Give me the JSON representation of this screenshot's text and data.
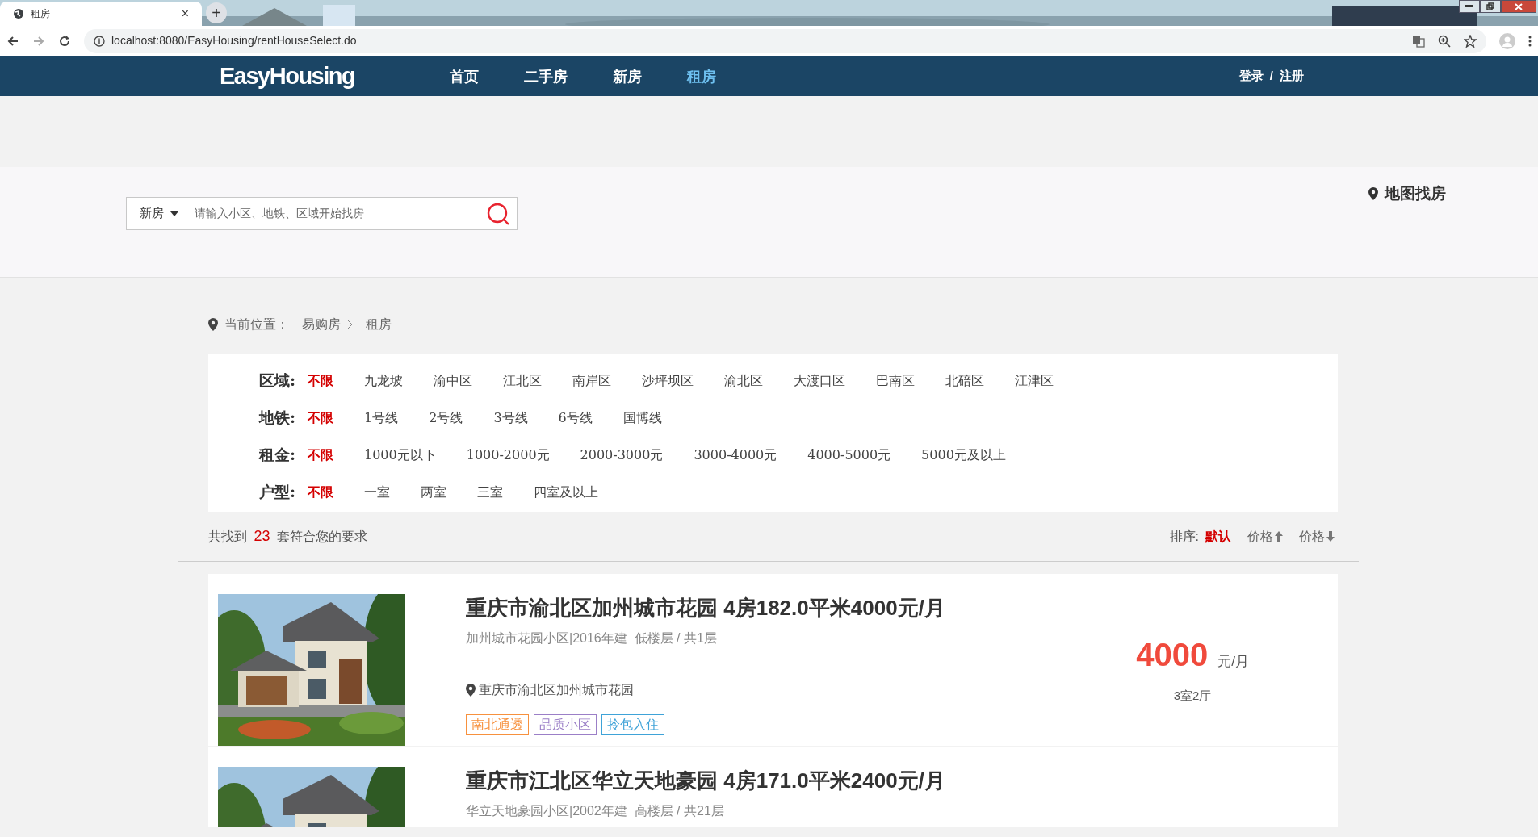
{
  "browser": {
    "tab_title": "租房",
    "tab_close": "×",
    "new_tab": "+",
    "url": "localhost:8080/EasyHousing/rentHouseSelect.do"
  },
  "nav": {
    "logo": "EasyHousing",
    "items": [
      {
        "label": "首页",
        "selected": false
      },
      {
        "label": "二手房",
        "selected": false
      },
      {
        "label": "新房",
        "selected": false
      },
      {
        "label": "租房",
        "selected": true
      }
    ],
    "auth": {
      "login": "登录",
      "separator": "/",
      "register": "注册"
    }
  },
  "search": {
    "type": "新房",
    "placeholder": "请输入小区、地铁、区域开始找房",
    "map_link": "地图找房"
  },
  "breadcrumb": {
    "label": "当前位置：",
    "items": [
      "易购房",
      "租房"
    ]
  },
  "filters": [
    {
      "label": "区域:",
      "options": [
        {
          "label": "不限",
          "selected": true
        },
        {
          "label": "九龙坡",
          "selected": false
        },
        {
          "label": "渝中区",
          "selected": false
        },
        {
          "label": "江北区",
          "selected": false
        },
        {
          "label": "南岸区",
          "selected": false
        },
        {
          "label": "沙坪坝区",
          "selected": false
        },
        {
          "label": "渝北区",
          "selected": false
        },
        {
          "label": "大渡口区",
          "selected": false
        },
        {
          "label": "巴南区",
          "selected": false
        },
        {
          "label": "北碚区",
          "selected": false
        },
        {
          "label": "江津区",
          "selected": false
        }
      ]
    },
    {
      "label": "地铁:",
      "options": [
        {
          "label": "不限",
          "selected": true
        },
        {
          "label": "1号线",
          "selected": false
        },
        {
          "label": "2号线",
          "selected": false
        },
        {
          "label": "3号线",
          "selected": false
        },
        {
          "label": "6号线",
          "selected": false
        },
        {
          "label": "国博线",
          "selected": false
        }
      ]
    },
    {
      "label": "租金:",
      "options": [
        {
          "label": "不限",
          "selected": true
        },
        {
          "label": "1000元以下",
          "selected": false
        },
        {
          "label": "1000-2000元",
          "selected": false
        },
        {
          "label": "2000-3000元",
          "selected": false
        },
        {
          "label": "3000-4000元",
          "selected": false
        },
        {
          "label": "4000-5000元",
          "selected": false
        },
        {
          "label": "5000元及以上",
          "selected": false
        }
      ]
    },
    {
      "label": "户型:",
      "options": [
        {
          "label": "不限",
          "selected": true
        },
        {
          "label": "一室",
          "selected": false
        },
        {
          "label": "两室",
          "selected": false
        },
        {
          "label": "三室",
          "selected": false
        },
        {
          "label": "四室及以上",
          "selected": false
        }
      ]
    }
  ],
  "results": {
    "prefix": "共找到",
    "count": "23",
    "suffix": "套符合您的要求"
  },
  "sort": {
    "label": "排序:",
    "options": [
      {
        "label": "默认",
        "kind": "plain",
        "selected": true
      },
      {
        "label": "价格",
        "kind": "up",
        "selected": false
      },
      {
        "label": "价格",
        "kind": "down",
        "selected": false
      }
    ]
  },
  "listings": [
    {
      "title": "重庆市渝北区加州城市花园 4房182.0平米4000元/月",
      "subtitle": "加州城市花园小区|2016年建  低楼层 / 共1层",
      "address": "重庆市渝北区加州城市花园",
      "tags": [
        {
          "label": "南北通透",
          "color": "#f7913e"
        },
        {
          "label": "品质小区",
          "color": "#9b7fc7"
        },
        {
          "label": "拎包入住",
          "color": "#3fa3d8"
        }
      ],
      "price": "4000",
      "unit": "元/月",
      "layout": "3室2厅"
    },
    {
      "title": "重庆市江北区华立天地豪园 4房171.0平米2400元/月",
      "subtitle": "华立天地豪园小区|2002年建  高楼层 / 共21层"
    }
  ]
}
